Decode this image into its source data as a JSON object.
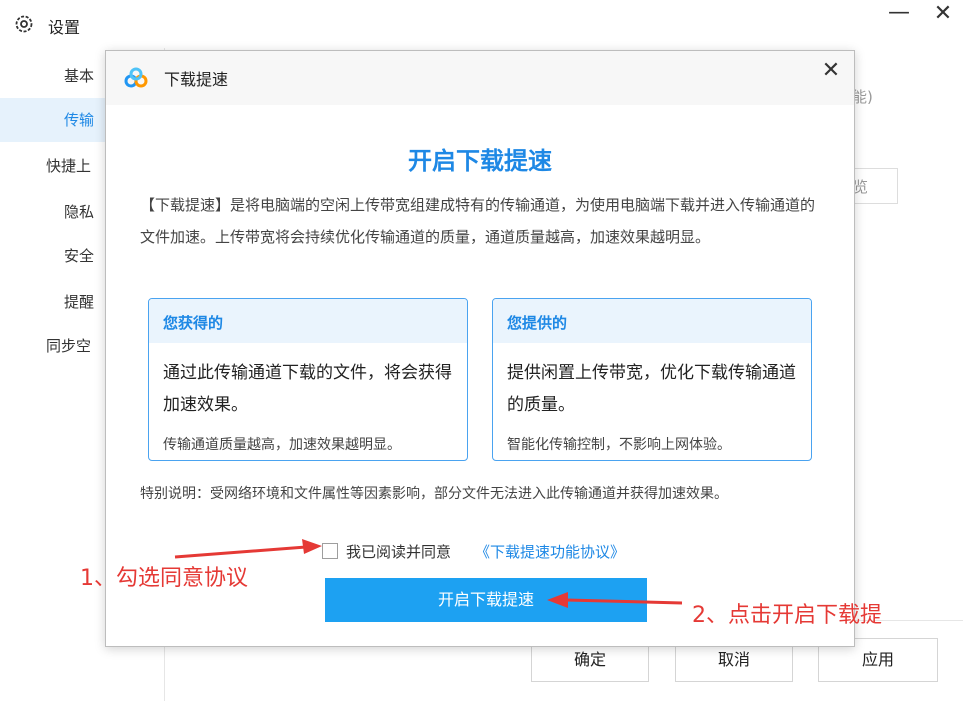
{
  "window": {
    "title": "设置",
    "minimize_label": "—",
    "close_label": "✕"
  },
  "sidebar": {
    "items": [
      {
        "label": "基本"
      },
      {
        "label": "传输"
      },
      {
        "label": "快捷上"
      },
      {
        "label": "隐私"
      },
      {
        "label": "安全"
      },
      {
        "label": "提醒"
      },
      {
        "label": "同步空"
      }
    ],
    "active_index": 1
  },
  "background": {
    "partial_text_1": "能)",
    "partial_text_2": "览"
  },
  "footer": {
    "ok_label": "确定",
    "cancel_label": "取消",
    "apply_label": "应用"
  },
  "dialog": {
    "title": "下载提速",
    "close_label": "✕",
    "heading": "开启下载提速",
    "description": "【下载提速】是将电脑端的空闲上传带宽组建成特有的传输通道，为使用电脑端下载并进入传输通道的文件加速。上传带宽将会持续优化传输通道的质量，通道质量越高，加速效果越明显。",
    "cards": [
      {
        "title": "您获得的",
        "main": "通过此传输通道下载的文件，将会获得加速效果。",
        "note": "传输通道质量越高，加速效果越明显。"
      },
      {
        "title": "您提供的",
        "main": "提供闲置上传带宽，优化下载传输通道的质量。",
        "note": "智能化传输控制，不影响上网体验。"
      }
    ],
    "notice": "特别说明：受网络环境和文件属性等因素影响，部分文件无法进入此传输通道并获得加速效果。",
    "agree_text": "我已阅读并同意",
    "agree_link": "《下载提速功能协议》",
    "agree_checked": false,
    "primary_button": "开启下载提速"
  },
  "annotations": {
    "step1": "1、勾选同意协议",
    "step2": "2、点击开启下载提"
  },
  "colors": {
    "accent": "#1e88e5",
    "primary_button": "#1da1f2",
    "annotation": "#e53935"
  }
}
